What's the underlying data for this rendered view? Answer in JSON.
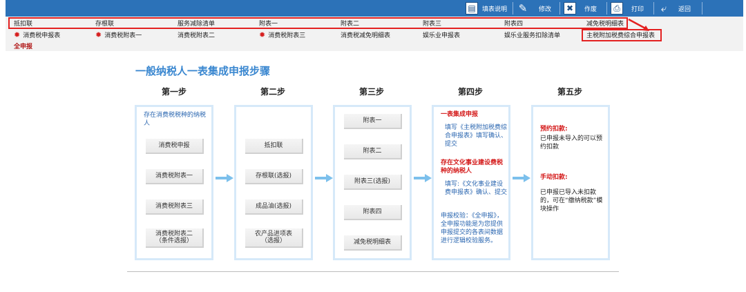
{
  "toolbar": {
    "help": "填表说明",
    "edit": "修改",
    "void": "作废",
    "print": "打印",
    "back": "返回"
  },
  "tabs_row1": [
    "抵扣联",
    "存根联",
    "服务减除清单",
    "附表一",
    "附表二",
    "附表三",
    "附表四",
    "减免税明细表"
  ],
  "tabs_row2": [
    "消费税申报表",
    "消费税附表一",
    "消费税附表二",
    "消费税附表三",
    "消费税减免明细表",
    "娱乐业申报表",
    "娱乐业服务扣除清单",
    "主税附加税费综合申报表"
  ],
  "full_check": "全申报",
  "title": "一般纳税人一表集成申报步骤",
  "steps": [
    "第一步",
    "第二步",
    "第三步",
    "第四步",
    "第五步"
  ],
  "step1": {
    "text": "存在消费税税种的纳税人",
    "items": [
      "消费税申报",
      "消费税附表一",
      "消费税附表三",
      "消费税附表二\n（条件选报）"
    ]
  },
  "step2": {
    "items": [
      "抵扣联",
      "存根联(选报)",
      "成品油(选报)",
      "农产品进项表\n（选报）"
    ]
  },
  "step3": {
    "items": [
      "附表一",
      "附表二",
      "附表三(选报)",
      "附表四",
      "减免税明细表"
    ]
  },
  "step4": {
    "h1": "一表集成申报",
    "t1": "填写《主税附加税费综合申报表》填写确认、提交",
    "h2": "存在文化事业建设费税种的纳税人",
    "t2": "填写:《文化事业建设费申报表》确认、提交",
    "t3": "申报校验：《全申报》，全申报功能是为您提供申报提交的各表间数据进行逻辑校验服务。"
  },
  "step5": {
    "h1": "预约扣款:",
    "t1": "已申报未导入的可以预约扣款",
    "h2": "手动扣款:",
    "t2": "已申报已导入未扣款的，可在“缴纳税款”模块操作"
  }
}
